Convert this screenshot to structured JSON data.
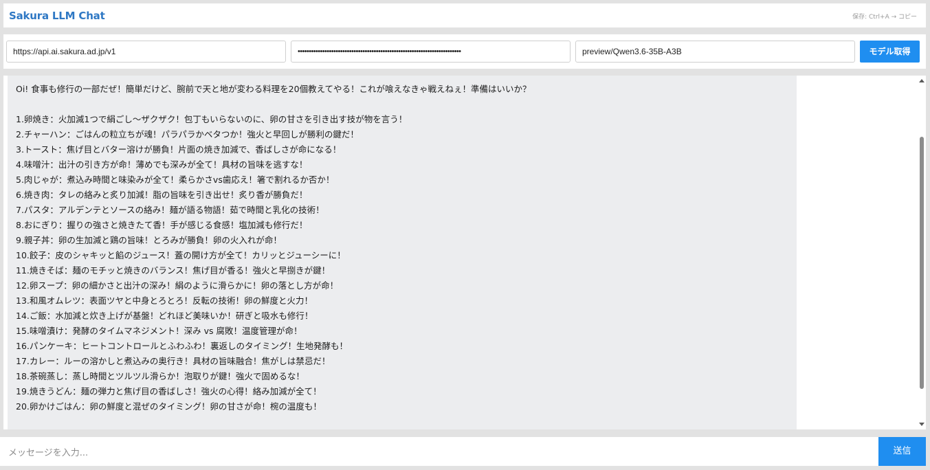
{
  "header": {
    "title": "Sakura LLM Chat",
    "save_hint": "保存: Ctrl+A → コピー"
  },
  "settings": {
    "api_url": "https://api.ai.sakura.ad.jp/v1",
    "api_key_masked": "•••••••••••••••••••••••••••••••••••••••••••••••••••••••••••••••••••••••••",
    "model": "preview/Qwen3.6-35B-A3B",
    "fetch_models_label": "モデル取得"
  },
  "chat": {
    "intro": "Oi! 食事も修行の一部だぜ！簡単だけど、腕前で天と地が変わる料理を20個教えてやる！これが喰えなきゃ戦えねぇ！準備はいいか？",
    "items": [
      "1.卵焼き：火加減1つで絹ごし〜ザクザク！包丁もいらないのに、卵の甘さを引き出す技が物を言う！",
      "2.チャーハン：ごはんの粒立ちが魂！パラパラかベタつか！強火と早回しが勝利の鍵だ！",
      "3.トースト：焦げ目とバター溶けが勝負！片面の焼き加減で、香ばしさが命になる！",
      "4.味噌汁：出汁の引き方が命！薄めでも深みが全て！具材の旨味を逃すな！",
      "5.肉じゃが：煮込み時間と味染みが全て！柔らかさvs歯応え！箸で割れるか否か！",
      "6.焼き肉：タレの絡みと炙り加減！脂の旨味を引き出せ！炙り香が勝負だ！",
      "7.パスタ：アルデンテとソースの絡み！麺が語る物語！茹で時間と乳化の技術！",
      "8.おにぎり：握りの強さと焼きたて香！手が感じる食感！塩加減も修行だ！",
      "9.親子丼：卵の生加減と鶏の旨味！とろみが勝負！卵の火入れが命！",
      "10.餃子：皮のシャキッと餡のジュース！蓋の開け方が全て！カリッとジューシーに！",
      "11.焼きそば：麺のモチッと焼きのバランス！焦げ目が香る！強火と早捌きが鍵！",
      "12.卵スープ：卵の細かさと出汁の深み！絹のように滑らかに！卵の落とし方が命！",
      "13.和風オムレツ：表面ツヤと中身とろとろ！反転の技術！卵の鮮度と火力！",
      "14.ご飯：水加減と炊き上げが基盤！どれほど美味いか！研ぎと吸水も修行！",
      "15.味噌漬け：発酵のタイムマネジメント！深み vs 腐敗！温度管理が命！",
      "16.パンケーキ：ヒートコントロールとふわふわ！裏返しのタイミング！生地発酵も！",
      "17.カレー：ルーの溶かしと煮込みの奥行き！具材の旨味融合！焦がしは禁忌だ！",
      "18.茶碗蒸し：蒸し時間とツルツル滑らか！泡取りが鍵！強火で固めるな！",
      "19.焼きうどん：麺の弾力と焦げ目の香ばしさ！強火の心得！絡み加減が全て！",
      "20.卵かけごはん：卵の鮮度と混ぜのタイミング！卵の甘さが命！椀の温度も！"
    ]
  },
  "composer": {
    "placeholder": "メッセージを入力...",
    "send_label": "送信"
  }
}
